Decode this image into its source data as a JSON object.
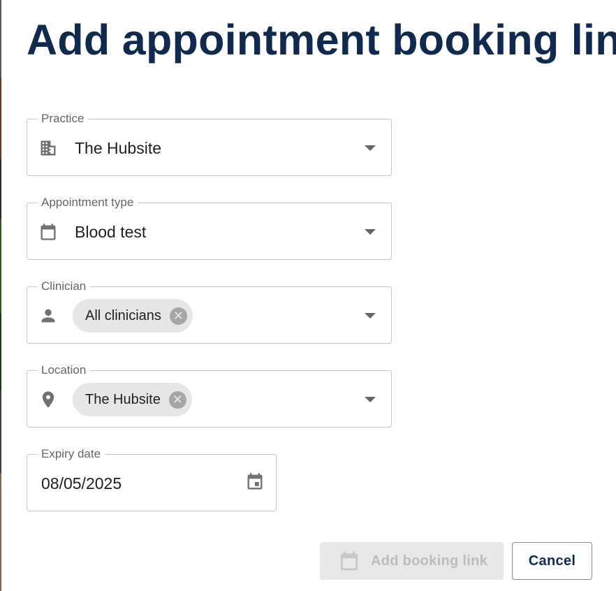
{
  "dialog": {
    "title": "Add appointment booking link"
  },
  "fields": {
    "practice": {
      "label": "Practice",
      "value": "The Hubsite",
      "icon": "building-icon"
    },
    "appointment_type": {
      "label": "Appointment type",
      "value": "Blood test",
      "icon": "calendar-icon"
    },
    "clinician": {
      "label": "Clinician",
      "chip": "All clinicians",
      "icon": "person-icon"
    },
    "location": {
      "label": "Location",
      "chip": "The Hubsite",
      "icon": "location-pin-icon"
    },
    "expiry_date": {
      "label": "Expiry date",
      "value": "08/05/2025",
      "icon": "calendar-event-icon"
    }
  },
  "actions": {
    "primary_label": "Add booking link",
    "primary_icon": "calendar-icon",
    "cancel_label": "Cancel"
  },
  "colors": {
    "title": "#0f2a4e",
    "border": "#c4c4c4",
    "chip_bg": "#e6e6e6",
    "disabled_bg": "#e8e8e8"
  }
}
